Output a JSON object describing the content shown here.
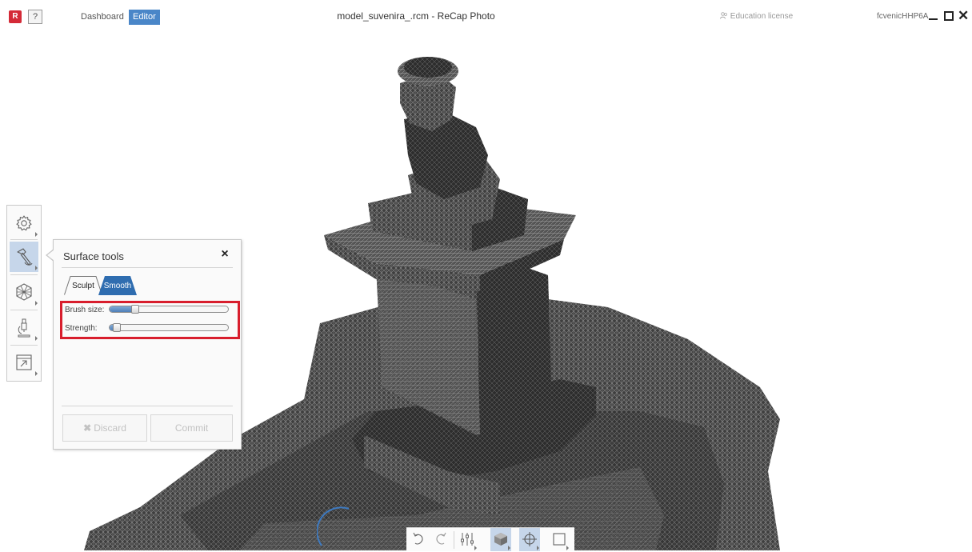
{
  "app": {
    "logo_letter": "R",
    "help_label": "?",
    "nav": {
      "dashboard": "Dashboard",
      "editor": "Editor"
    },
    "window_title": "model_suvenira_.rcm - ReCap Photo",
    "license": "Education license",
    "user": "fcvenicHHP6A",
    "accent_color": "#4a86c8"
  },
  "left_toolbar": {
    "tools": [
      {
        "name": "settings",
        "icon": "gear-icon"
      },
      {
        "name": "surface-tools",
        "icon": "hammer-icon",
        "active": true
      },
      {
        "name": "mesh",
        "icon": "polyhedron-icon"
      },
      {
        "name": "analysis",
        "icon": "microscope-icon"
      },
      {
        "name": "export",
        "icon": "export-icon"
      }
    ]
  },
  "surface_tools": {
    "title": "Surface tools",
    "close_label": "×",
    "tabs": [
      {
        "label": "Sculpt",
        "active": false
      },
      {
        "label": "Smooth",
        "active": true
      }
    ],
    "brush_size": {
      "label": "Brush size:",
      "value": 0.18
    },
    "strength": {
      "label": "Strength:",
      "value": 0.03
    },
    "discard_label": "Discard",
    "discard_icon": "✖",
    "commit_label": "Commit"
  },
  "bottom_toolbar": {
    "tools": [
      "undo-icon",
      "redo-icon",
      "adjust-icon",
      "cube-icon",
      "target-icon",
      "crop-icon"
    ]
  },
  "highlight_color": "#d81e2d"
}
